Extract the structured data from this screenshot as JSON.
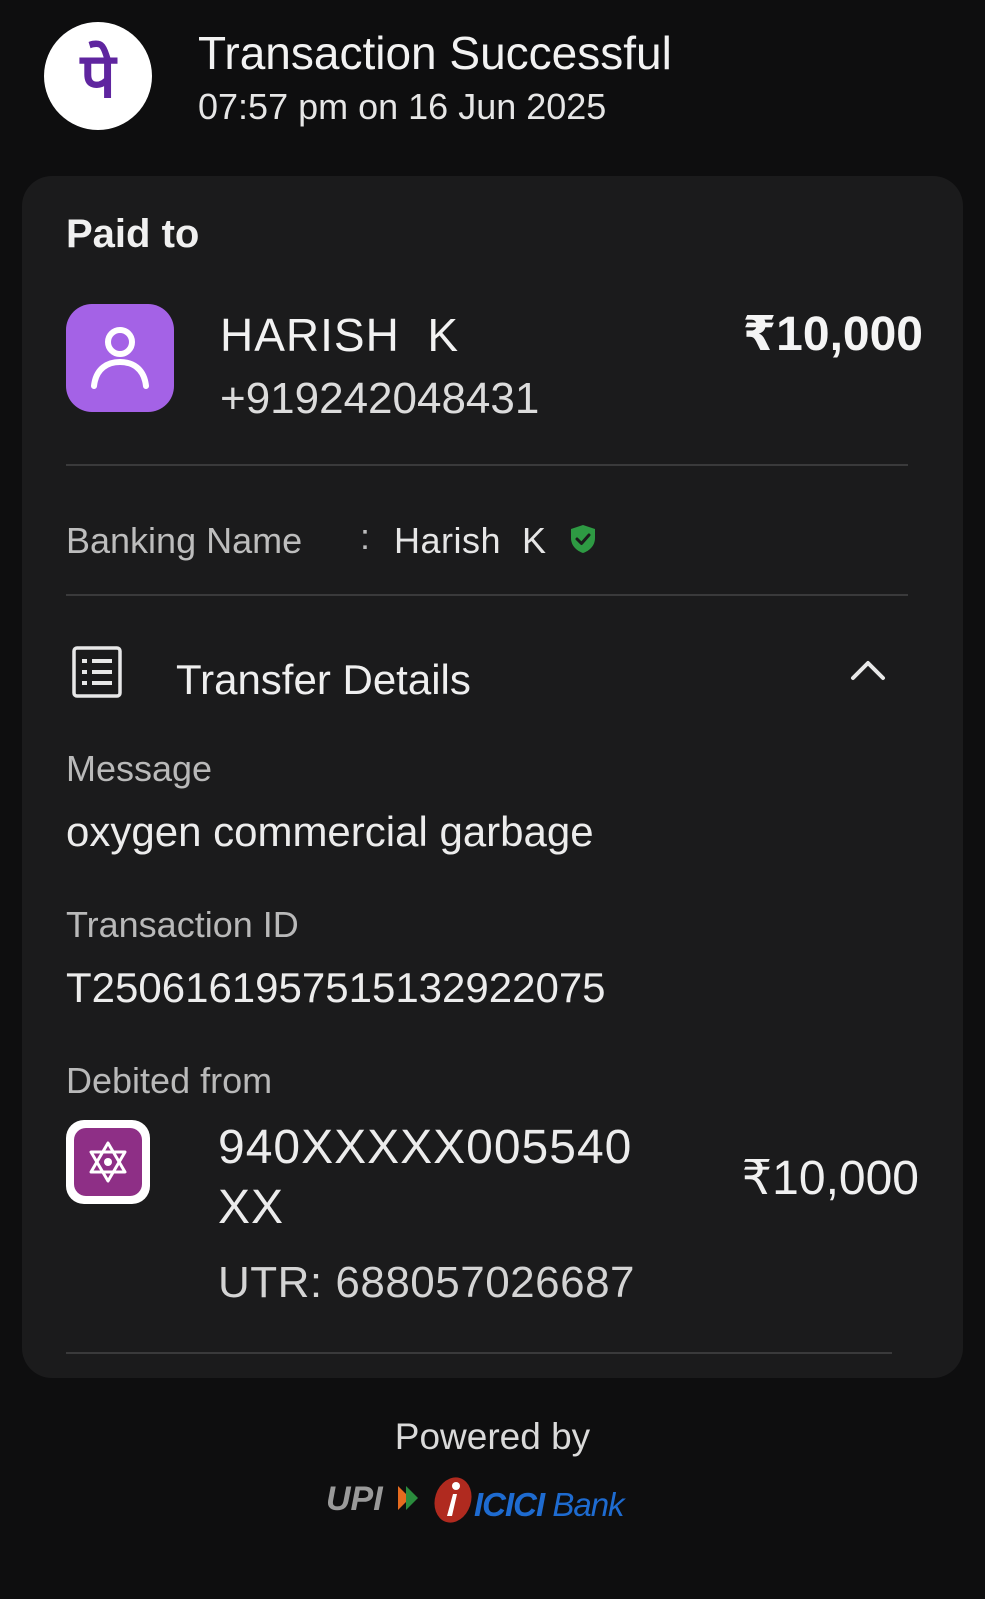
{
  "header": {
    "title": "Transaction Successful",
    "timestamp": "07:57 pm on 16 Jun 2025",
    "app_logo_glyph": "पे",
    "app_logo_color": "#5f259f"
  },
  "card": {
    "paid_to_label": "Paid to",
    "payee": {
      "name": "HARISH  K",
      "phone": "+919242048431",
      "amount": "₹10,000",
      "avatar_icon": "person-icon",
      "avatar_color": "#a462e6"
    },
    "banking_name": {
      "label": "Banking Name",
      "separator": ":",
      "value": "Harish  K",
      "verified_icon": "verified-shield-icon",
      "verified_color": "#2e9a43"
    },
    "transfer_details": {
      "title": "Transfer Details",
      "icon": "receipt-list-icon",
      "toggle_icon": "chevron-up-icon",
      "message_label": "Message",
      "message_value": "oxygen commercial garbage",
      "transaction_id_label": "Transaction ID",
      "transaction_id_value": "T2506161957515132922075",
      "debited_from_label": "Debited from",
      "account_line1": "940XXXXX005540",
      "account_line2": "XX",
      "utr": "UTR: 688057026687",
      "debit_amount": "₹10,000",
      "bank_icon": "star-of-david-bank-icon",
      "bank_icon_color": "#8e2f86"
    }
  },
  "footer": {
    "powered_by": "Powered by",
    "upi_logo_text": "UPI",
    "icici_brand": "ICICI",
    "icici_bank": " Bank",
    "icici_color": "#1e6bd0"
  }
}
